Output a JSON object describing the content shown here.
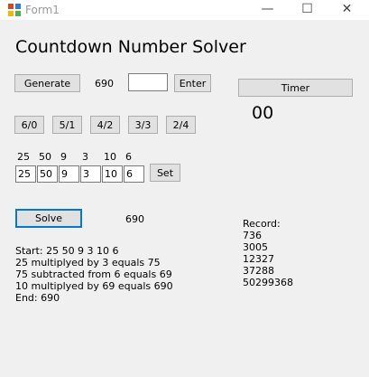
{
  "window": {
    "title": "Form1",
    "controls": [
      "—",
      "☐",
      "✕"
    ]
  },
  "app_title": "Countdown Number Solver",
  "generate_label": "Generate",
  "generated_target": "690",
  "target_input": {
    "value": "",
    "placeholder": ""
  },
  "enter_label": "Enter",
  "timer_label": "Timer",
  "timer_value": "00",
  "split_buttons": [
    "6/0",
    "5/1",
    "4/2",
    "3/3",
    "2/4"
  ],
  "numbers_display": [
    "25",
    "50",
    "9",
    "3",
    "10",
    "6"
  ],
  "number_inputs": [
    "25",
    "50",
    "9",
    "3",
    "10",
    "6"
  ],
  "set_label": "Set",
  "solve_label": "Solve",
  "solve_result": "690",
  "steps": [
    "Start: 25  50  9  3  10  6",
    "25 multiplyed by 3 equals 75",
    "75 subtracted from 6 equals 69",
    "10 multiplyed by 69 equals 690",
    "End: 690"
  ],
  "record": {
    "title": "Record:",
    "values": [
      "736",
      "3005",
      "12327",
      "37288",
      "50299368"
    ]
  }
}
